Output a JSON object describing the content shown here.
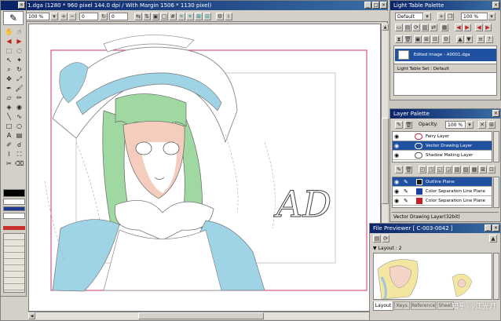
{
  "main_window": {
    "title": "1.dga (1280 * 960 pixel 144.0 dpi / With Margin 1506 * 1130 pixel)",
    "zoom_value": "100 %",
    "rotation_value": "0",
    "frame_value": "0"
  },
  "toolbox": {
    "icons": [
      "brush-icon",
      "hand-icon",
      "arrow-left-icon",
      "arrow-right-icon",
      "marquee-icon",
      "lasso-icon",
      "select-icon",
      "magic-wand-icon",
      "zoom-icon",
      "move-icon",
      "pen-icon",
      "eraser-icon",
      "pencil-icon",
      "bucket-icon",
      "line-icon",
      "curve-icon",
      "rectangle-icon",
      "ellipse-icon",
      "text-icon",
      "eyedropper-icon"
    ],
    "swatches": [
      "#000000",
      "#ffffff",
      "#203890",
      "#ffffff",
      "#c83030"
    ]
  },
  "canvas": {
    "signature": "AD",
    "frame_color": "#d03070"
  },
  "light_table": {
    "title": "Light Table Palette",
    "dropdown_value": "Default",
    "percent": "100 %",
    "item_label": "Edited Image - A0001.dga",
    "set_label": "Light Table Set : Default"
  },
  "layer_palette": {
    "title": "Layer Palette",
    "opacity_label": "Opacity:",
    "opacity_value": "100 %",
    "layers": [
      {
        "name": "Fairy Layer",
        "selected": false,
        "color": "#ffffff"
      },
      {
        "name": "Vector Drawing Layer",
        "selected": true,
        "color": "#2050a0"
      },
      {
        "name": "Shadow Making Layer",
        "selected": false,
        "color": "#ffffff"
      }
    ],
    "sub_layers": [
      {
        "name": "Outline Plane",
        "selected": true,
        "color": "#1a1a1a"
      },
      {
        "name": "Color Separation Line Plane",
        "selected": false,
        "color": "#2040a0"
      },
      {
        "name": "Color Separation Line Plane",
        "selected": false,
        "color": "#c02020"
      }
    ],
    "footer": "Vector Drawing Layer(32bit)"
  },
  "file_previewer": {
    "title": "File Previewer [ C-003-0042 ]",
    "layout_label": "Layout : 2",
    "tabs": [
      "Layout",
      "Keys",
      "Reference",
      "Sheet"
    ],
    "watermark": "知乎 @江光灯"
  }
}
